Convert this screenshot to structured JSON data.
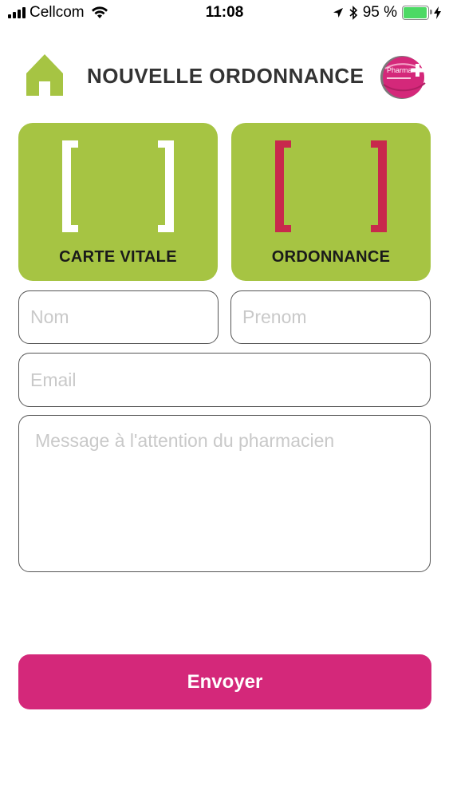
{
  "status_bar": {
    "carrier": "Cellcom",
    "time": "11:08",
    "battery": "95 %",
    "battery_level": 0.95
  },
  "header": {
    "title": "NOUVELLE ORDONNANCE",
    "logo_text": "Pharma"
  },
  "tiles": {
    "carte_vitale": {
      "label": "CARTE VITALE",
      "bracket_color": "#ffffff"
    },
    "ordonnance": {
      "label": "ORDONNANCE",
      "bracket_color": "#c8294c"
    }
  },
  "form": {
    "nom_placeholder": "Nom",
    "prenom_placeholder": "Prenom",
    "email_placeholder": "Email",
    "message_placeholder": "Message à l'attention du pharmacien",
    "nom_value": "",
    "prenom_value": "",
    "email_value": "",
    "message_value": ""
  },
  "send_button": {
    "label": "Envoyer"
  },
  "colors": {
    "accent_green": "#a6c443",
    "accent_pink": "#d4287a",
    "bracket_red": "#c8294c"
  }
}
